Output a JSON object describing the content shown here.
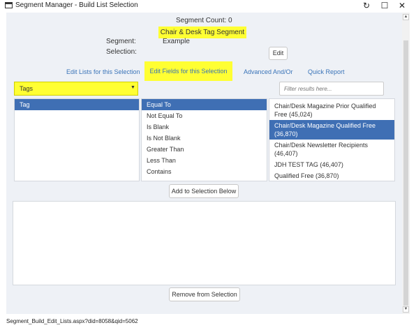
{
  "window": {
    "title": "Segment Manager - Build List Selection",
    "controls": {
      "refresh": "↻",
      "maximize": "☐",
      "close": "✕"
    }
  },
  "header": {
    "segment_count": "Segment Count: 0",
    "segment_name": "Chair & Desk Tag Segment",
    "segment_label": "Segment:",
    "segment_value": "Example",
    "selection_label": "Selection:",
    "edit_button": "Edit"
  },
  "tabs": [
    {
      "label": "Edit Lists for this Selection",
      "active": false
    },
    {
      "label": "Edit Fields for this Selection",
      "active": true
    },
    {
      "label": "Advanced And/Or",
      "active": false
    },
    {
      "label": "Quick Report",
      "active": false
    }
  ],
  "field_dropdown": {
    "value": "Tags",
    "arrow": "▼"
  },
  "filter": {
    "placeholder": "Filter results here..."
  },
  "fields_panel": {
    "header": "Tag"
  },
  "operators": {
    "items": [
      "Equal To",
      "Not Equal To",
      "Is Blank",
      "Is Not Blank",
      "Greater Than",
      "Less Than",
      "Contains"
    ],
    "selected": "Equal To"
  },
  "results": {
    "items": [
      "Chair/Desk Magazine Prior Qualified Free (45,024)",
      "Chair/Desk Magazine Qualified Free (36,870)",
      "Chair/Desk Newsletter Recipients (46,407)",
      "JDH TEST TAG (46,407)",
      "Qualified Free (36,870)"
    ],
    "selected": "Chair/Desk Magazine Qualified Free (36,870)"
  },
  "add_button": "Add to Selection Below",
  "remove_button": "Remove from Selection",
  "colors": {
    "highlight": "#ffff33",
    "selected": "#3f6fb4",
    "link": "#3a74b8",
    "background": "#eef1f6"
  },
  "status_bar": {
    "url": "Segment_Build_Edit_Lists.aspx?did=8058&qid=5062"
  }
}
